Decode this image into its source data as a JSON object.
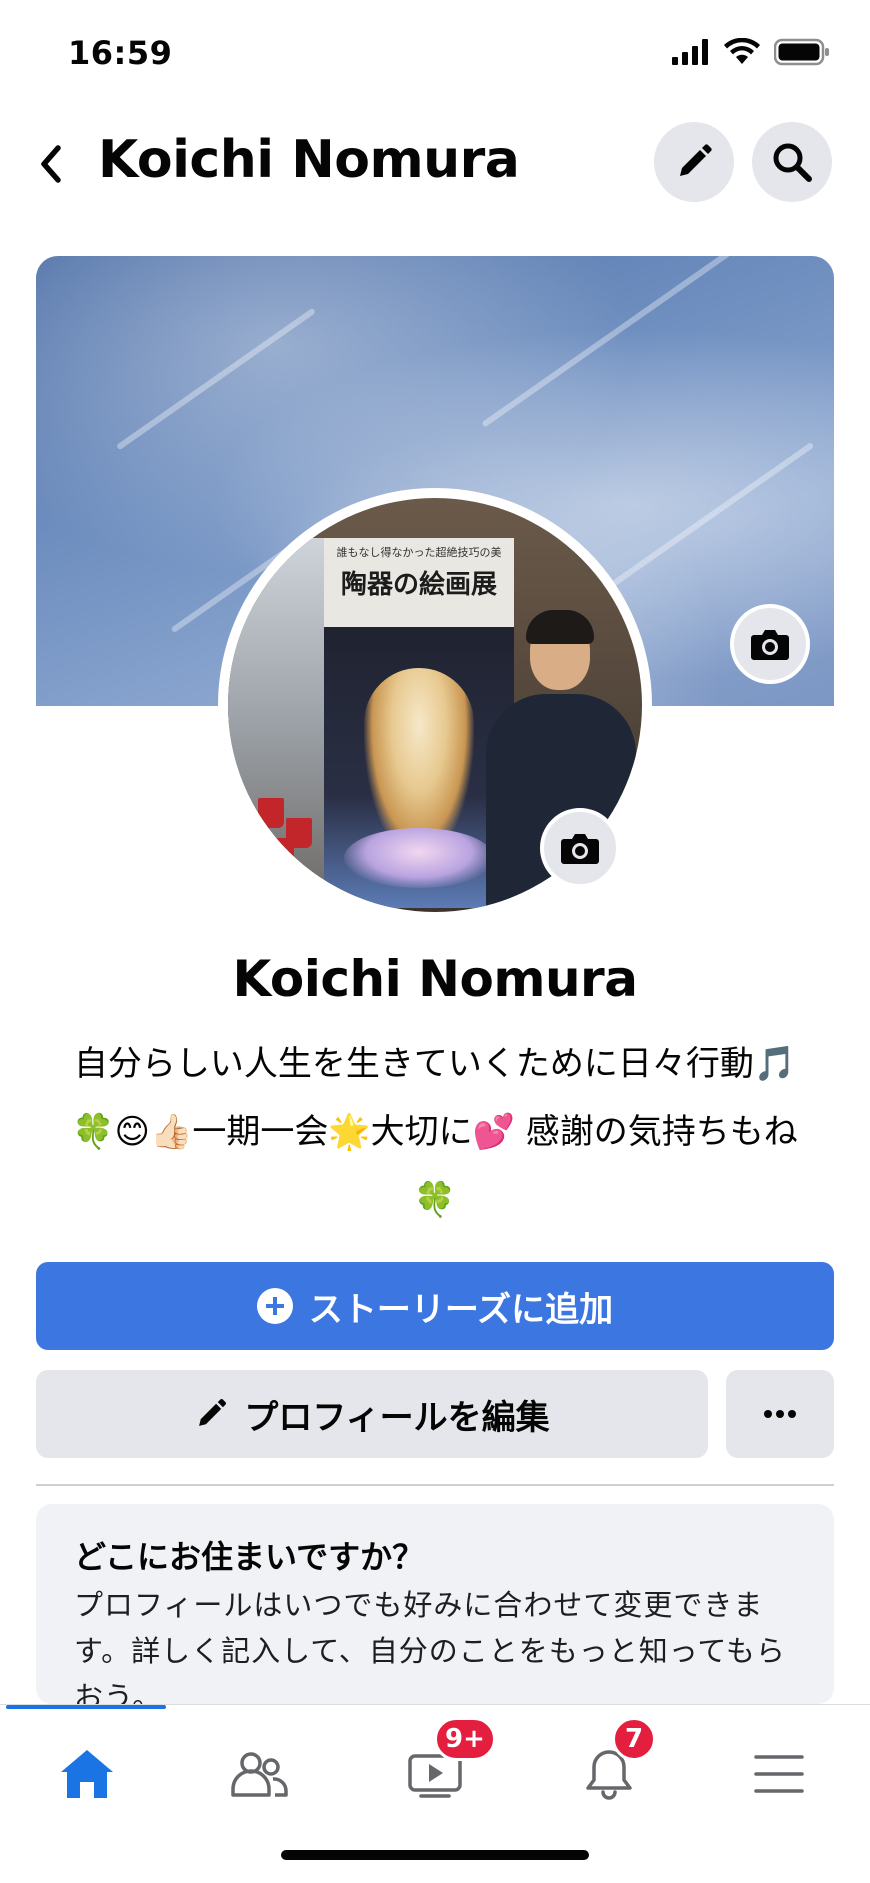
{
  "status_bar": {
    "time": "16:59",
    "signal_icon": "cellular-signal-icon",
    "wifi_icon": "wifi-icon",
    "battery_icon": "battery-icon"
  },
  "header": {
    "back_icon": "chevron-left-icon",
    "title": "Koichi Nomura",
    "edit_icon": "pencil-icon",
    "search_icon": "search-icon"
  },
  "cover": {
    "camera_icon": "camera-icon"
  },
  "avatar": {
    "camera_icon": "camera-icon",
    "poster_subtitle": "誰もなし得なかった超絶技巧の美",
    "poster_title": "陶器の絵画展"
  },
  "profile": {
    "name": "Koichi Nomura",
    "bio_line1": "自分らしい人生を生きていくために日々行動🎵",
    "bio_line2": "🍀😊👍🏻一期一会🌟大切に💕 感謝の気持ちもね",
    "bio_line3": "🍀"
  },
  "actions": {
    "add_story_label": "ストーリーズに追加",
    "edit_profile_label": "プロフィールを編集",
    "more_label": "···"
  },
  "location_card": {
    "title": "どこにお住まいですか？",
    "body": "プロフィールはいつでも好みに合わせて変更できます。詳しく記入して、自分のことをもっと知ってもらおう。"
  },
  "bottom_nav": {
    "items": [
      {
        "name": "home",
        "icon": "home-icon",
        "active": true
      },
      {
        "name": "friends",
        "icon": "friends-icon"
      },
      {
        "name": "watch",
        "icon": "video-icon",
        "badge": "9+"
      },
      {
        "name": "notifications",
        "icon": "bell-icon",
        "badge": "7"
      },
      {
        "name": "menu",
        "icon": "menu-icon"
      }
    ]
  },
  "colors": {
    "accent": "#3b76e1",
    "button_gray": "#e4e6eb",
    "badge_red": "#e41e3f",
    "card_bg": "#f0f2f5"
  }
}
